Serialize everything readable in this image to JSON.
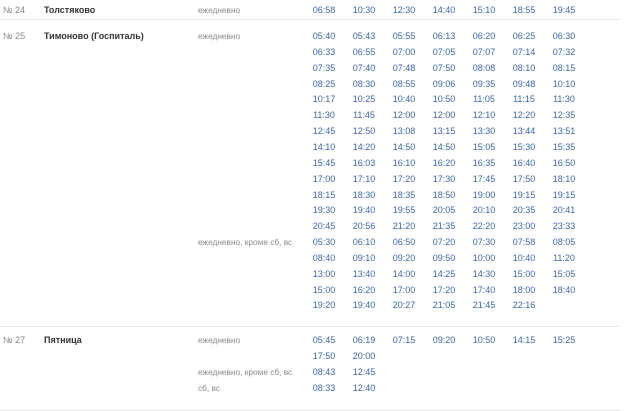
{
  "routes": [
    {
      "number": "№ 24",
      "stop": "Толстяково",
      "schedules": [
        {
          "label": "ежедневно",
          "rows": [
            [
              "06:58",
              "10:30",
              "12:30",
              "14:40",
              "15:10",
              "18:55",
              "19:45"
            ]
          ]
        }
      ]
    },
    {
      "number": "№ 25",
      "stop": "Тимоново (Госпиталь)",
      "schedules": [
        {
          "label": "ежедневно",
          "rows": [
            [
              "05:40",
              "05:43",
              "05:55",
              "06:13",
              "06:20",
              "06:25",
              "06:30"
            ],
            [
              "06:33",
              "06:55",
              "07:00",
              "07:05",
              "07:07",
              "07:14",
              "07:32"
            ],
            [
              "07:35",
              "07:40",
              "07:48",
              "07:50",
              "08:08",
              "08:10",
              "08:15"
            ],
            [
              "08:25",
              "08:30",
              "08:55",
              "09:06",
              "09:35",
              "09:48",
              "10:10"
            ],
            [
              "10:17",
              "10:25",
              "10:40",
              "10:50",
              "11:05",
              "11:15",
              "11:30"
            ],
            [
              "11:30",
              "11:45",
              "12:00",
              "12:00",
              "12:10",
              "12:20",
              "12:35"
            ],
            [
              "12:45",
              "12:50",
              "13:08",
              "13:15",
              "13:30",
              "13:44",
              "13:51"
            ],
            [
              "14:10",
              "14:20",
              "14:50",
              "14:50",
              "15:05",
              "15:30",
              "15:35"
            ],
            [
              "15:45",
              "16:03",
              "16:10",
              "16:20",
              "16:35",
              "16:40",
              "16:50"
            ],
            [
              "17:00",
              "17:10",
              "17:20",
              "17:30",
              "17:45",
              "17:50",
              "18:10"
            ],
            [
              "18:15",
              "18:30",
              "18:35",
              "18:50",
              "19:00",
              "19:15",
              "19:15"
            ],
            [
              "19:30",
              "19:40",
              "19:55",
              "20:05",
              "20:10",
              "20:35",
              "20:41"
            ],
            [
              "20:45",
              "20:56",
              "21:20",
              "21:35",
              "22:20",
              "23:00",
              "23:33"
            ]
          ]
        },
        {
          "label": "ежедневно, кроме сб, вс",
          "rows": [
            [
              "05:30",
              "06:10",
              "06:50",
              "07:20",
              "07:30",
              "07:58",
              "08:05"
            ],
            [
              "08:40",
              "09:10",
              "09:20",
              "09:50",
              "10:00",
              "10:40",
              "11:20"
            ],
            [
              "13:00",
              "13:40",
              "14:00",
              "14:25",
              "14:30",
              "15:00",
              "15:05"
            ],
            [
              "15:00",
              "16:20",
              "17:00",
              "17:20",
              "17:40",
              "18:00",
              "18:40"
            ],
            [
              "19:20",
              "19:40",
              "20:27",
              "21:05",
              "21:45",
              "22:16"
            ]
          ]
        }
      ]
    },
    {
      "number": "№ 27",
      "stop": "Пятница",
      "schedules": [
        {
          "label": "ежедневно",
          "rows": [
            [
              "05:45",
              "06:19",
              "07:15",
              "09:20",
              "10:50",
              "14:15",
              "15:25"
            ],
            [
              "17:50",
              "20:00"
            ]
          ]
        },
        {
          "label": "ежедневно, кроме сб, вс",
          "rows": [
            [
              "08:43",
              "12:45"
            ]
          ]
        },
        {
          "label": "сб, вс",
          "rows": [
            [
              "08:33",
              "12:40"
            ]
          ]
        }
      ]
    }
  ],
  "colors": {
    "time": "#3b67a9",
    "label": "#8a8a8a",
    "stop": "#333333",
    "divider": "#e6e6e6"
  }
}
